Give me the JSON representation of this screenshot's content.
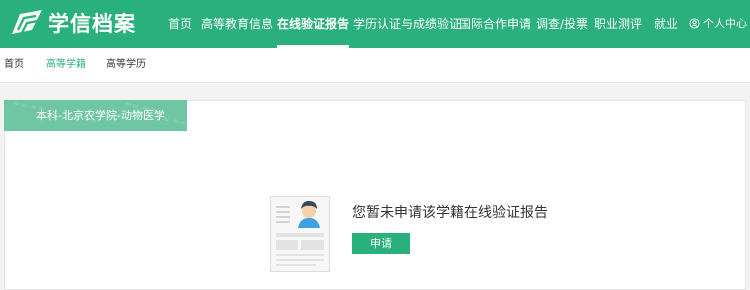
{
  "header": {
    "brand": "学信档案",
    "nav": [
      {
        "label": "首页",
        "active": false
      },
      {
        "label": "高等教育信息",
        "active": false
      },
      {
        "label": "在线验证报告",
        "active": true
      },
      {
        "label": "学历认证与成绩验证",
        "active": false
      },
      {
        "label": "国际合作申请",
        "active": false
      },
      {
        "label": "调查/投票",
        "active": false
      },
      {
        "label": "职业测评",
        "active": false
      },
      {
        "label": "就业",
        "active": false
      }
    ],
    "user_menu": {
      "label": "个人中心",
      "icon": "user-circle-icon",
      "caret": "chevron-down-icon"
    }
  },
  "subnav": {
    "items": [
      {
        "label": "首页",
        "active": false
      },
      {
        "label": "高等学籍",
        "active": true
      },
      {
        "label": "高等学历",
        "active": false
      }
    ]
  },
  "main": {
    "record_tab": {
      "label": "本科-北京农学院-动物医学"
    },
    "empty_state": {
      "message": "您暂未申请该学籍在线验证报告",
      "button_label": "申请",
      "icon": "document-profile-icon"
    }
  },
  "colors": {
    "brand": "#29b07c",
    "tab": "#6fc6a3",
    "page_bg": "#f3f3f3"
  }
}
